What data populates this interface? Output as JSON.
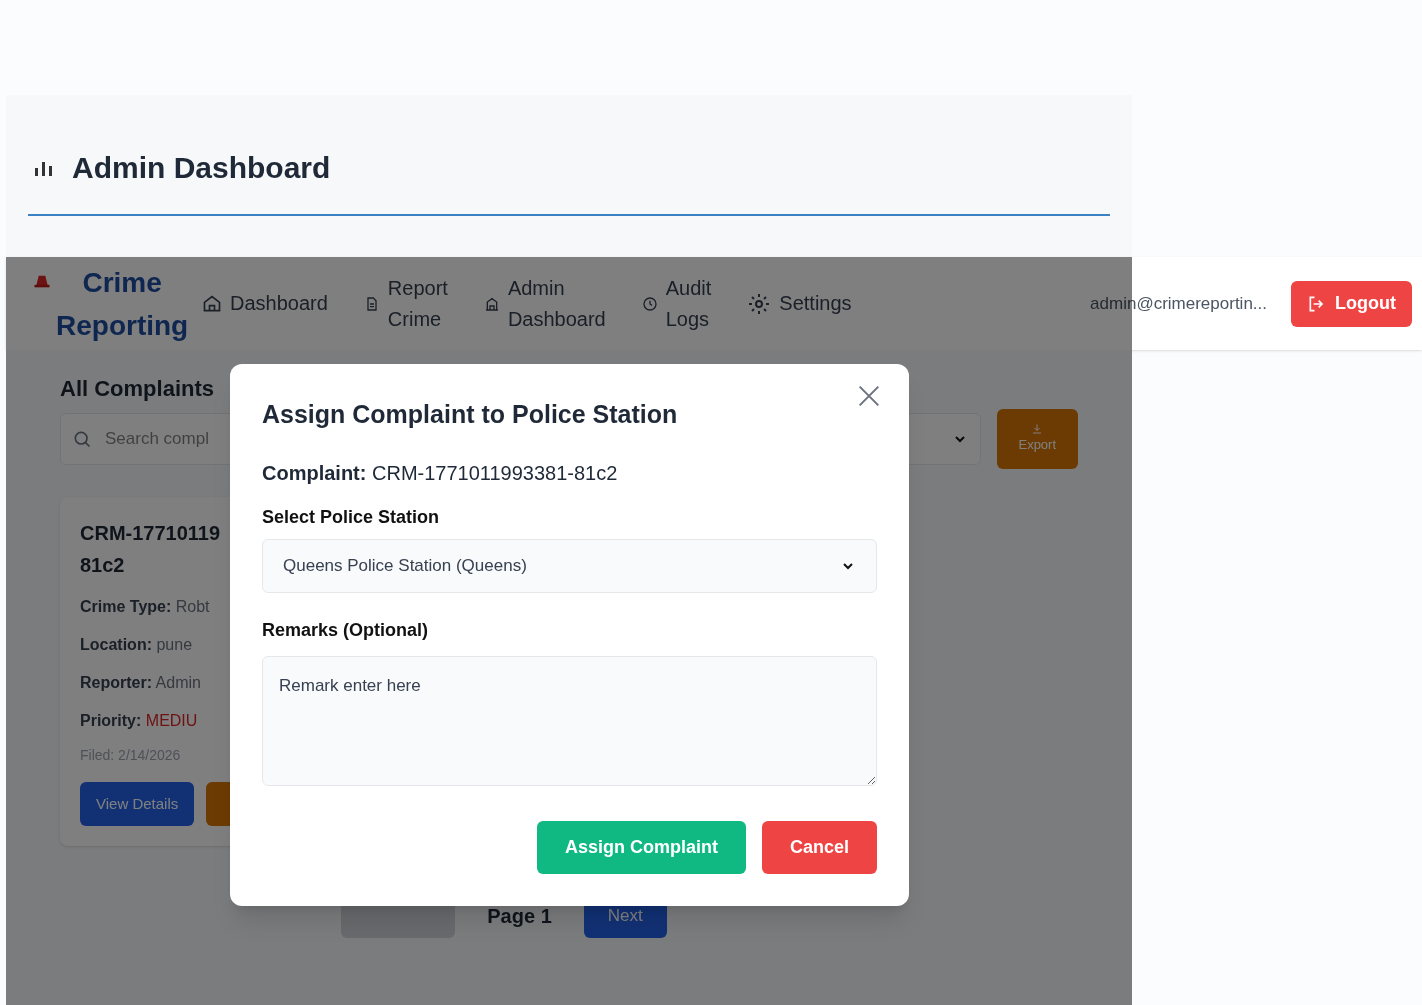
{
  "header": {
    "title": "Admin Dashboard"
  },
  "nav": {
    "brand": "Crime Reporting",
    "items": [
      {
        "label": "Dashboard",
        "kind": "home"
      },
      {
        "label": "Report Crime",
        "kind": "document"
      },
      {
        "label": "Admin Dashboard",
        "kind": "building"
      },
      {
        "label": "Audit Logs",
        "kind": "clock"
      },
      {
        "label": "Settings",
        "kind": "gear"
      }
    ],
    "user_email": "admin@crimereportin...",
    "logout": "Logout"
  },
  "content": {
    "title": "All Complaints",
    "search": {
      "placeholder": "Search compl"
    },
    "export": "Export",
    "card": {
      "id_lines": [
        "CRM-17710119",
        "81c2"
      ],
      "fields": [
        {
          "label": "Crime Type:",
          "value": "Robt",
          "kind": "text"
        },
        {
          "label": "Location:",
          "value": "pune",
          "kind": "text"
        },
        {
          "label": "Reporter:",
          "value": "Admin",
          "kind": "text"
        },
        {
          "label": "Priority:",
          "value": "MEDIU",
          "kind": "priority"
        }
      ],
      "filed": "Filed: 2/14/2026",
      "view": "View Details"
    },
    "pagination": {
      "previous_disabled": true,
      "page": "Page 1",
      "next": "Next"
    }
  },
  "modal": {
    "title": "Assign Complaint to Police Station",
    "complaint_label": "Complaint:",
    "complaint_value": "CRM-1771011993381-81c2",
    "station_label": "Select Police Station",
    "station_value": "Queens Police Station (Queens)",
    "remarks_label": "Remarks (Optional)",
    "remarks_value": "Remark enter here",
    "buttons": [
      {
        "label": "Assign Complaint",
        "kind": "primary"
      },
      {
        "label": "Cancel",
        "kind": "danger"
      }
    ]
  }
}
